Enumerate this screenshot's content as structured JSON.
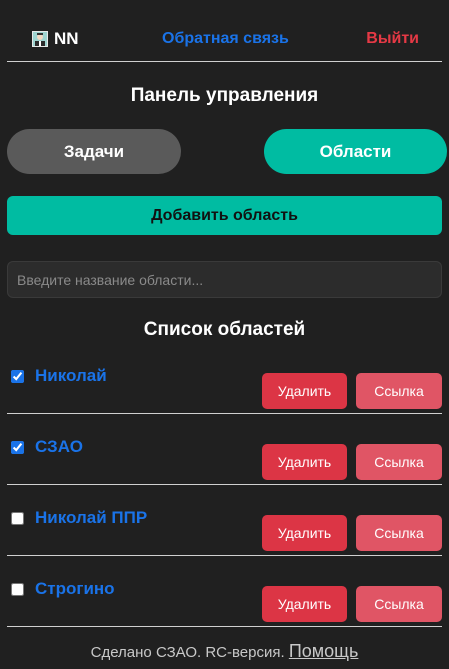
{
  "header": {
    "user_name": "NN",
    "avatar_icon": "user-avatar-icon",
    "feedback_label": "Обратная связь",
    "logout_label": "Выйти"
  },
  "panel": {
    "title": "Панель управления",
    "tabs": [
      {
        "label": "Задачи",
        "active": false
      },
      {
        "label": "Области",
        "active": true
      }
    ]
  },
  "add_area": {
    "button_label": "Добавить область",
    "input_placeholder": "Введите название области...",
    "input_value": ""
  },
  "areas": {
    "title": "Список областей",
    "items": [
      {
        "name": "Николай",
        "checked": true,
        "delete_label": "Удалить",
        "link_label": "Ссылка"
      },
      {
        "name": "СЗАО",
        "checked": true,
        "delete_label": "Удалить",
        "link_label": "Ссылка"
      },
      {
        "name": "Николай ППР",
        "checked": false,
        "delete_label": "Удалить",
        "link_label": "Ссылка"
      },
      {
        "name": "Строгино",
        "checked": false,
        "delete_label": "Удалить",
        "link_label": "Ссылка"
      }
    ]
  },
  "footer": {
    "text": "Сделано СЗАО. RC-версия.",
    "help_label": "Помощь"
  },
  "colors": {
    "background": "#202020",
    "accent": "#00bca2",
    "link": "#1a73e8",
    "danger": "#dc3545",
    "muted_button": "#5a5a5a"
  }
}
